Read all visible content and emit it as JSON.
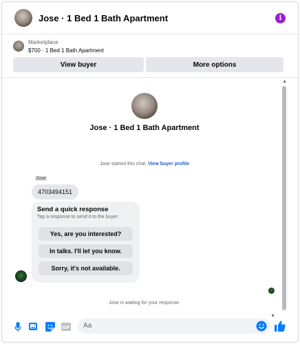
{
  "header": {
    "title": "Jose · 1 Bed 1 Bath Apartment",
    "info_icon": "info-icon",
    "accent": "#9a1ed2"
  },
  "marketplace": {
    "label": "Marketplace",
    "item": "$700 · 1 Bed 1 Bath Apartment",
    "view_buyer_label": "View buyer",
    "more_options_label": "More options"
  },
  "profile": {
    "name": "Jose · 1 Bed 1 Bath Apartment"
  },
  "chat": {
    "started_text": "Jose started this chat.",
    "view_profile_link": "View buyer profile",
    "sender_name": "Jose",
    "phone_message": "4703494151",
    "quick_response": {
      "title": "Send a quick response",
      "subtitle": "Tap a response to send it to the buyer.",
      "options": [
        "Yes, are you interested?",
        "In talks. I'll let you know.",
        "Sorry, it's not available."
      ]
    },
    "waiting_text": "Jose is waiting for your response."
  },
  "composer": {
    "placeholder": "Aa",
    "icons": [
      "microphone-icon",
      "photo-icon",
      "sticker-icon",
      "gif-icon",
      "emoji-icon",
      "thumbs-up-icon"
    ],
    "accent": "#0a7cff"
  }
}
